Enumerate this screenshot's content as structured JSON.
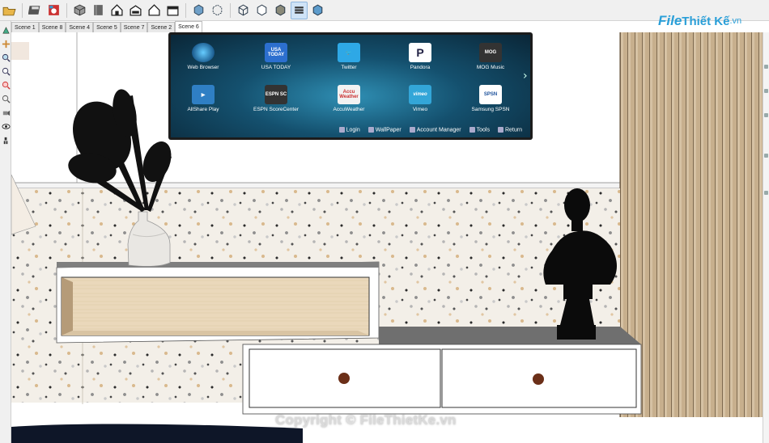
{
  "toolbar": {
    "buttons": [
      "open-icon",
      "save-icon",
      "model-info-icon",
      "components-icon",
      "iso-icon",
      "top-icon",
      "front-icon",
      "right-icon",
      "back-icon",
      "left-icon",
      "xray-icon",
      "back-edges-icon",
      "wireframe-icon",
      "hidden-line-icon",
      "shaded-icon",
      "shaded-textures-icon"
    ]
  },
  "scene_tabs": [
    "Scene 1",
    "Scene 8",
    "Scene 4",
    "Scene 5",
    "Scene 7",
    "Scene 2",
    "Scene 6"
  ],
  "active_scene": "Scene 6",
  "watermark": {
    "logo_file": "File",
    "logo_rest": "Thiết Kế",
    "logo_vn": ".vn",
    "copyright": "Copyright © FileThietKe.vn"
  },
  "tv": {
    "apps_row1": [
      "Web Browser",
      "USA TODAY",
      "Twitter",
      "Pandora",
      "MOG Music"
    ],
    "apps_row2": [
      "AllShare Play",
      "ESPN ScoreCenter",
      "AccuWeather",
      "Vimeo",
      "Samsung SPSN"
    ],
    "icon_labels": [
      "USA TODAY",
      "P",
      "MOG",
      "ESPN SC",
      "Accu Weather",
      "vimeo",
      "SPSN"
    ],
    "bottom": [
      "Login",
      "WallPaper",
      "Account Manager",
      "Tools",
      "Return"
    ]
  },
  "colors": {
    "accent": "#2a9fd8",
    "toolbar_bg": "#f0f0f0",
    "wood": "#e9d7ba",
    "slat": "#c9b396"
  }
}
